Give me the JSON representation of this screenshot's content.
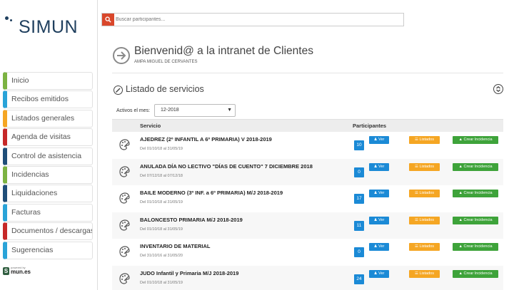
{
  "brand": {
    "name": "SIMUN",
    "powered_by": "powered by",
    "powered_name": "mun.es",
    "powered_initial": "S"
  },
  "colors": {
    "primary": "#1b8ad6",
    "listados": "#f5a623",
    "incidencia": "#3ea33a",
    "search_button": "#d9472b"
  },
  "sidebar": {
    "items": [
      {
        "label": "Inicio",
        "color": "#7cb342"
      },
      {
        "label": "Recibos emitidos",
        "color": "#29a3d8"
      },
      {
        "label": "Listados generales",
        "color": "#f5a623"
      },
      {
        "label": "Agenda de visitas",
        "color": "#c62828"
      },
      {
        "label": "Control de asistencia",
        "color": "#1f4e79"
      },
      {
        "label": "Incidencias",
        "color": "#7cb342"
      },
      {
        "label": "Liquidaciones",
        "color": "#1f4e79"
      },
      {
        "label": "Facturas",
        "color": "#29a3d8"
      },
      {
        "label": "Documentos / descargas",
        "color": "#c62828"
      },
      {
        "label": "Sugerencias",
        "color": "#29a3d8"
      }
    ]
  },
  "search": {
    "placeholder": "Buscar participantes..."
  },
  "welcome": {
    "title": "Bienvenid@ a la intranet de Clientes",
    "subtitle": "AMPA MIGUEL DE CERVANTES"
  },
  "section": {
    "title": "Listado de servicios"
  },
  "filter": {
    "label": "Activos el mes:",
    "value": "12-2018"
  },
  "table": {
    "headers": {
      "service": "Servicio",
      "participants": "Participantes"
    },
    "ver_label": "Ver",
    "listados_label": "Listados",
    "incidencia_label": "Crear Incidencia",
    "rows": [
      {
        "name": "AJEDREZ (2º INFANTIL A 6º PRIMARIA) V 2018-2019",
        "dates": "Del 01/10/18 al 31/05/19",
        "count": "10"
      },
      {
        "name": "ANULADA DÍA NO LECTIVO \"DÍAS DE CUENTO\" 7 DICIEMBRE 2018",
        "dates": "Del 07/12/18 al 07/12/18",
        "count": "0"
      },
      {
        "name": "BAILE MODERNO (3º INF. a 6º PRIMARIA) M/J 2018-2019",
        "dates": "Del 01/10/18 al 31/05/19",
        "count": "17"
      },
      {
        "name": "BALONCESTO PRIMARIA M/J 2018-2019",
        "dates": "Del 01/10/18 al 31/05/19",
        "count": "11"
      },
      {
        "name": "INVENTARIO DE MATERIAL",
        "dates": "Del 31/10/16 al 31/05/20",
        "count": "0"
      },
      {
        "name": "JUDO Infantil y Primaria M/J 2018-2019",
        "dates": "Del 01/10/18 al 31/05/19",
        "count": "24"
      }
    ]
  }
}
